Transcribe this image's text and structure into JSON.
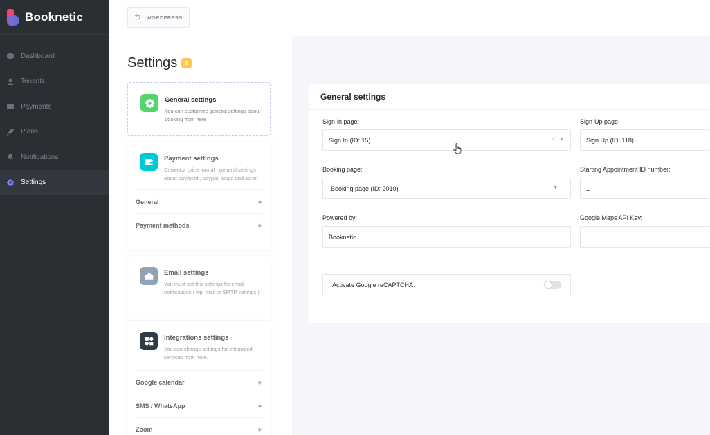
{
  "brand": {
    "name": "Booknetic"
  },
  "sidebar": {
    "items": [
      {
        "label": "Dashboard",
        "icon": "cube-icon"
      },
      {
        "label": "Tenants",
        "icon": "user-icon"
      },
      {
        "label": "Payments",
        "icon": "credit-card-icon"
      },
      {
        "label": "Plans",
        "icon": "rocket-icon"
      },
      {
        "label": "Notifications",
        "icon": "bell-icon"
      },
      {
        "label": "Settings",
        "icon": "gear-icon",
        "active": true
      }
    ]
  },
  "topbar": {
    "wordpress_label": "WORDPRESS"
  },
  "settings": {
    "title": "Settings",
    "count": "9",
    "cards": {
      "general": {
        "title": "General settings",
        "desc": "You can customize general settings about booking from here",
        "icon_color": "#53d56c"
      },
      "payment": {
        "title": "Payment settings",
        "desc": "Currency, price format , general settings about payment , paypal, stripe and so on",
        "icon_color": "#00c9d7",
        "items": [
          "General",
          "Payment methods"
        ]
      },
      "email": {
        "title": "Email settings",
        "desc": "You must set this settings for email notifications ( wp_mail or SMTP settings )",
        "icon_color": "#8fa3b7"
      },
      "integrations": {
        "title": "Integrations settings",
        "desc": "You can change settings for integrated services from here.",
        "icon_color": "#2f3b45",
        "items": [
          "Google calendar",
          "SMS / WhatsApp",
          "Zoom"
        ]
      }
    }
  },
  "panel": {
    "title": "General settings",
    "signin": {
      "label": "Sign-in page:",
      "value": "Sign In (ID: 15)"
    },
    "signup": {
      "label": "Sign-Up page:",
      "value": "Sign Up (ID: 118)"
    },
    "booking": {
      "label": "Booking page:",
      "value": "Booking page (ID: 2010)"
    },
    "start_id": {
      "label": "Starting Appointment ID number:",
      "value": "1"
    },
    "powered": {
      "label": "Powered by:",
      "value": "Booknetic"
    },
    "maps": {
      "label": "Google Maps API Key:",
      "value": ""
    },
    "recaptcha": {
      "label": "Activate Google reCAPTCHA:",
      "enabled": false
    }
  },
  "colors": {
    "accent": "#6c70dc",
    "sidebar_bg": "#2a2f34",
    "badge": "#ffc54f"
  }
}
